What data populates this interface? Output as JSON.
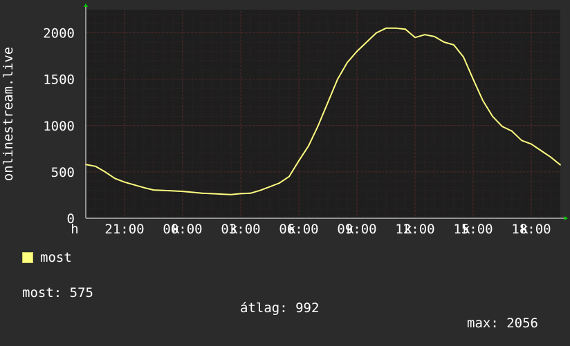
{
  "chart_data": {
    "type": "line",
    "ylabel": "onlinestream.live",
    "ylim": [
      0,
      2250
    ],
    "yticks": [
      0,
      500,
      1000,
      1500,
      2000
    ],
    "x_hours_range": [
      19,
      43.5
    ],
    "x_ticks": [
      {
        "hour": 21,
        "label": "21:00"
      },
      {
        "hour": 24,
        "label": "00:00"
      },
      {
        "hour": 27,
        "label": "03:00"
      },
      {
        "hour": 30,
        "label": "06:00"
      },
      {
        "hour": 33,
        "label": "09:00"
      },
      {
        "hour": 36,
        "label": "12:00"
      },
      {
        "hour": 39,
        "label": "15:00"
      },
      {
        "hour": 42,
        "label": "18:00"
      }
    ],
    "x_start_label": "h",
    "tick_suffix": "k",
    "grid": true,
    "colors": {
      "background": "#2b2b2b",
      "plot_background": "#1e1e1e",
      "grid": "#5a2a2a",
      "grid_minor": "#3a2424",
      "line": "#ffff80",
      "axis_text": "#ffffff",
      "arrow": "#00cc00"
    },
    "series": [
      {
        "name": "most",
        "x": [
          19,
          19.5,
          20,
          20.5,
          21,
          21.5,
          22,
          22.5,
          23,
          23.5,
          24,
          24.5,
          25,
          25.5,
          26,
          26.5,
          27,
          27.5,
          28,
          28.5,
          29,
          29.5,
          30,
          30.5,
          31,
          31.5,
          32,
          32.5,
          33,
          33.5,
          34,
          34.5,
          35,
          35.5,
          36,
          36.5,
          37,
          37.5,
          38,
          38.5,
          39,
          39.5,
          40,
          40.5,
          41,
          41.5,
          42,
          42.5,
          43,
          43.5
        ],
        "values": [
          580,
          560,
          500,
          430,
          390,
          360,
          330,
          305,
          300,
          295,
          290,
          280,
          270,
          265,
          260,
          255,
          265,
          270,
          300,
          340,
          380,
          450,
          620,
          780,
          1000,
          1250,
          1500,
          1680,
          1800,
          1900,
          2000,
          2050,
          2050,
          2040,
          1950,
          1980,
          1960,
          1900,
          1870,
          1740,
          1500,
          1270,
          1100,
          990,
          940,
          840,
          800,
          730,
          660,
          575
        ]
      }
    ]
  },
  "legend": {
    "items": [
      {
        "label": "most",
        "color": "#ffff80"
      }
    ]
  },
  "stats": {
    "current_label": "most:",
    "current_value": "575",
    "avg_label": "átlag:",
    "avg_value": "992",
    "max_label": "max:",
    "max_value": "2056"
  }
}
